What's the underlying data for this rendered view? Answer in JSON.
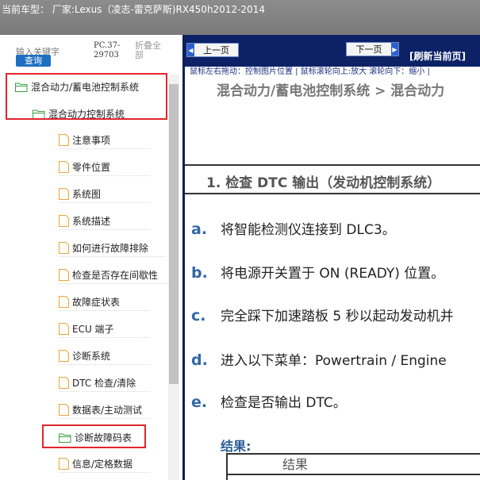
{
  "window": {
    "title": "当前车型： 厂家:Lexus（凌志-雷克萨斯)RX450h2012-2014"
  },
  "sidebar": {
    "keyword_label": "输入关键字",
    "query_button": "查询",
    "pc_code": "PC.37-29703",
    "collapse_all": "折叠全部",
    "tree": [
      {
        "label": "混合动力/蓄电池控制系统",
        "type": "folder",
        "level": 0,
        "highlighted": true
      },
      {
        "label": "混合动力控制系统",
        "type": "folder",
        "level": 1,
        "highlighted": true
      },
      {
        "label": "注意事项",
        "type": "page",
        "level": 2
      },
      {
        "label": "零件位置",
        "type": "page",
        "level": 2
      },
      {
        "label": "系统图",
        "type": "page",
        "level": 2
      },
      {
        "label": "系统描述",
        "type": "page",
        "level": 2
      },
      {
        "label": "如何进行故障排除",
        "type": "page",
        "level": 2
      },
      {
        "label": "检查是否存在间歇性",
        "type": "page",
        "level": 2
      },
      {
        "label": "故障症状表",
        "type": "page",
        "level": 2
      },
      {
        "label": "ECU 端子",
        "type": "page",
        "level": 2
      },
      {
        "label": "诊断系统",
        "type": "page",
        "level": 2
      },
      {
        "label": "DTC 检查/清除",
        "type": "page",
        "level": 2
      },
      {
        "label": "数据表/主动测试",
        "type": "page",
        "level": 2
      },
      {
        "label": "诊断故障码表",
        "type": "folder",
        "level": 2,
        "highlighted": true
      },
      {
        "label": "信息/定格数据",
        "type": "page",
        "level": 2
      }
    ]
  },
  "content": {
    "nav": {
      "prev_label": "上一页",
      "next_label": "下一页",
      "refresh_label": "[刷新当前页]"
    },
    "hint": "鼠标左右拖动：控制图片位置 | 鼠标滚轮向上:放大  滚轮向下：缩小 |",
    "breadcrumb": "混合动力/蓄电池控制系统 > 混合动力",
    "step_title": "1. 检查 DTC 输出（发动机控制系统）",
    "items": [
      {
        "letter": "a.",
        "text": "将智能检测仪连接到 DLC3。"
      },
      {
        "letter": "b.",
        "text": "将电源开关置于 ON (READY) 位置。"
      },
      {
        "letter": "c.",
        "text": "完全踩下加速踏板 5 秒以起动发动机并"
      },
      {
        "letter": "d.",
        "text": "进入以下菜单：Powertrain / Engine"
      },
      {
        "letter": "e.",
        "text": "检查是否输出 DTC。"
      }
    ],
    "result_label": "结果:",
    "result_table_header": "结果"
  },
  "colors": {
    "highlight_border": "#e0262d",
    "nav_bar": "#0d2266",
    "item_letter": "#3367a8",
    "folder_icon": "#3aa043"
  }
}
